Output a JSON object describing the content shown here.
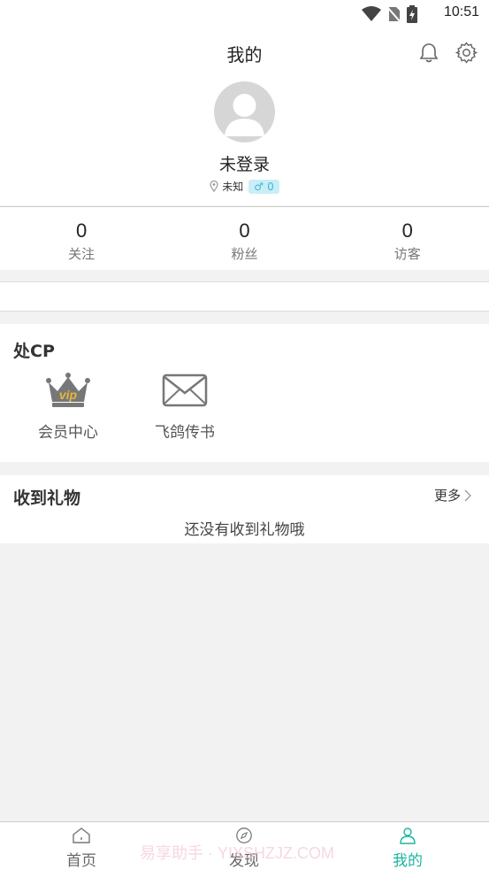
{
  "status_bar": {
    "time": "10:51"
  },
  "header": {
    "title": "我的"
  },
  "profile": {
    "username": "未登录",
    "location": "未知",
    "gender_symbol": "♂",
    "gender_value": "0"
  },
  "stats": [
    {
      "value": "0",
      "label": "关注"
    },
    {
      "value": "0",
      "label": "粉丝"
    },
    {
      "value": "0",
      "label": "访客"
    }
  ],
  "cp": {
    "title": "处CP",
    "items": [
      {
        "label": "会员中心",
        "badge": "vip"
      },
      {
        "label": "飞鸽传书"
      }
    ]
  },
  "gifts": {
    "title": "收到礼物",
    "more": "更多",
    "empty": "还没有收到礼物哦"
  },
  "tabs": [
    {
      "label": "首页"
    },
    {
      "label": "发现"
    },
    {
      "label": "我的"
    }
  ],
  "colors": {
    "accent": "#1ab5a0",
    "gender_bg": "#c9eef7",
    "gender_fg": "#3fb6d6",
    "crown": "#e8b73a"
  },
  "watermark": "易享助手 · YIXSHZJZ.COM"
}
